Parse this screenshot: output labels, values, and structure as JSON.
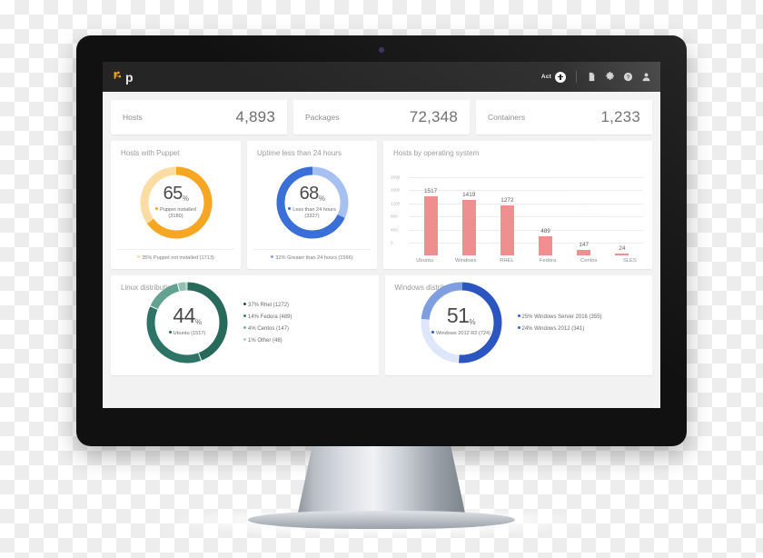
{
  "topbar": {
    "logo_text": "p",
    "act_label": "Act",
    "icons": [
      "plus-circle-icon",
      "document-icon",
      "gear-icon",
      "help-icon",
      "user-icon"
    ]
  },
  "stats": [
    {
      "label": "Hosts",
      "value": "4,893"
    },
    {
      "label": "Packages",
      "value": "72,348"
    },
    {
      "label": "Containers",
      "value": "1,233"
    }
  ],
  "puppet_card": {
    "title": "Hosts with Puppet",
    "percent": "65",
    "pct_sign": "%",
    "sublabel": "Puppet installed (3180)",
    "footer": "35% Puppet not installed (1713)",
    "chart_data": {
      "type": "pie",
      "title": "Hosts with Puppet",
      "categories": [
        "Puppet installed",
        "Puppet not installed"
      ],
      "values": [
        3180,
        1713
      ],
      "percents": [
        65,
        35
      ],
      "colors": [
        "#f5a623",
        "#fbdca2"
      ],
      "legend": "bottom"
    }
  },
  "uptime_card": {
    "title": "Uptime less than 24 hours",
    "percent": "68",
    "pct_sign": "%",
    "sublabel": "Less than 24 hours (3327)",
    "footer": "32% Greater than 24 hours (1566)",
    "chart_data": {
      "type": "pie",
      "title": "Uptime less than 24 hours",
      "categories": [
        "Less than 24 hours",
        "Greater than 24 hours"
      ],
      "values": [
        3327,
        1566
      ],
      "percents": [
        68,
        32
      ],
      "colors": [
        "#3a6fd8",
        "#a7c0f2"
      ],
      "legend": "bottom"
    }
  },
  "os_card": {
    "title": "Hosts by operating system",
    "chart_data": {
      "type": "bar",
      "title": "Hosts by operating system",
      "categories": [
        "Ubuntu",
        "Windows",
        "RHEL",
        "Fedora",
        "Centos",
        "SLES"
      ],
      "values": [
        1517,
        1419,
        1272,
        489,
        147,
        24
      ],
      "xlabel": "",
      "ylabel": "",
      "ylim": [
        0,
        2000
      ],
      "yticks": [
        0,
        400,
        800,
        1200,
        1600,
        2000
      ],
      "grid": true,
      "bar_color": "#ef8e8e",
      "legend": "none"
    }
  },
  "linux_card": {
    "title": "Linux distribution",
    "percent": "44",
    "pct_sign": "%",
    "sublabel": "Ubuntu (1517)",
    "legend": [
      {
        "text": "37% Rhel (1272)",
        "color": "#20524a"
      },
      {
        "text": "14% Fedora (489)",
        "color": "#3f7d70"
      },
      {
        "text": "4% Centos  (147)",
        "color": "#7dae9f"
      },
      {
        "text": "1% Other (48)",
        "color": "#abcec2"
      }
    ],
    "chart_data": {
      "type": "pie",
      "title": "Linux distribution",
      "categories": [
        "Ubuntu",
        "Rhel",
        "Fedora",
        "Centos",
        "Other"
      ],
      "values": [
        1517,
        1272,
        489,
        147,
        48
      ],
      "percents": [
        44,
        37,
        14,
        4,
        1
      ],
      "colors": [
        "#276a5c",
        "#2d7466",
        "#63a191",
        "#8fc0b2",
        "#b6d6cb"
      ],
      "legend": "right"
    }
  },
  "windows_card": {
    "title": "Windows distribution",
    "percent": "51",
    "pct_sign": "%",
    "sublabel": "Windows 2012 R2 (724)",
    "legend": [
      {
        "text": "25%  Windows Server 2016  (355)",
        "color": "#3a62c8"
      },
      {
        "text": "24% Windows 2012 (341)",
        "color": "#3a62c8"
      }
    ],
    "chart_data": {
      "type": "pie",
      "title": "Windows distribution",
      "categories": [
        "Windows 2012 R2",
        "Windows Server 2016",
        "Windows 2012"
      ],
      "values": [
        724,
        355,
        341
      ],
      "percents": [
        51,
        25,
        24
      ],
      "colors": [
        "#2b55c0",
        "#7e9ee0",
        "#dee6fa"
      ],
      "legend": "right"
    }
  }
}
